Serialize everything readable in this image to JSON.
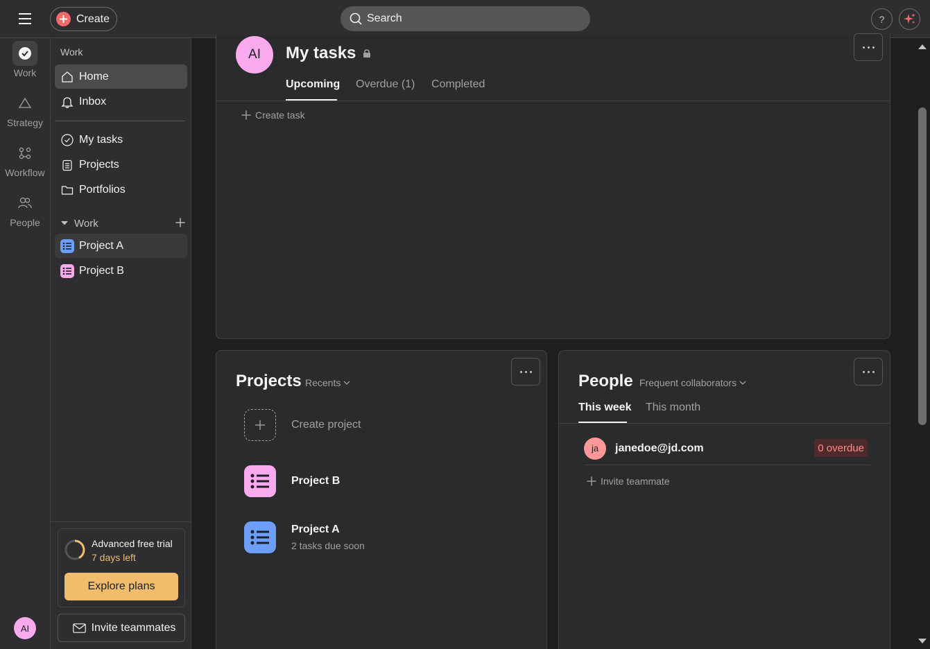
{
  "topbar": {
    "create_label": "Create",
    "search_placeholder": "Search",
    "help_label": "?",
    "menu_icon": "hamburger-menu-icon",
    "ai_icon": "sparkle-icon"
  },
  "rail": {
    "items": [
      {
        "label": "Work",
        "icon": "check-circle-icon"
      },
      {
        "label": "Strategy",
        "icon": "triangle-icon"
      },
      {
        "label": "Workflow",
        "icon": "workflow-icon"
      },
      {
        "label": "People",
        "icon": "people-icon"
      }
    ],
    "avatar_initials": "AI"
  },
  "sidebar": {
    "heading": "Work",
    "nav": [
      {
        "label": "Home",
        "icon": "home-icon"
      },
      {
        "label": "Inbox",
        "icon": "bell-icon"
      }
    ],
    "nav2": [
      {
        "label": "My tasks",
        "icon": "check-circle-icon"
      },
      {
        "label": "Projects",
        "icon": "clipboard-icon"
      },
      {
        "label": "Portfolios",
        "icon": "folder-icon"
      }
    ],
    "section_label": "Work",
    "projects": [
      {
        "label": "Project A",
        "color": "#4573d2"
      },
      {
        "label": "Project B",
        "color": "#e362e3"
      }
    ],
    "trial": {
      "title": "Advanced free trial",
      "days_left": "7 days left",
      "explore_label": "Explore plans"
    },
    "invite_label": "Invite teammates"
  },
  "my_tasks": {
    "avatar_initials": "AI",
    "title": "My tasks",
    "tabs": [
      "Upcoming",
      "Overdue (1)",
      "Completed"
    ],
    "create_task_label": "Create task"
  },
  "projects_card": {
    "title": "Projects",
    "filter": "Recents",
    "create_label": "Create project",
    "items": [
      {
        "name": "Project B",
        "sub": "",
        "color": "#f9aaef"
      },
      {
        "name": "Project A",
        "sub": "2 tasks due soon",
        "color": "#6d9ef9"
      }
    ]
  },
  "people_card": {
    "title": "People",
    "filter": "Frequent collaborators",
    "tabs": [
      "This week",
      "This month"
    ],
    "person": {
      "initials": "ja",
      "email": "janedoe@jd.com",
      "badge": "0 overdue"
    },
    "invite_label": "Invite teammate"
  },
  "colors": {
    "accent_create": "#f06a6a",
    "trial_gold": "#f1bd6c",
    "avatar_pink": "#f9aaef"
  }
}
